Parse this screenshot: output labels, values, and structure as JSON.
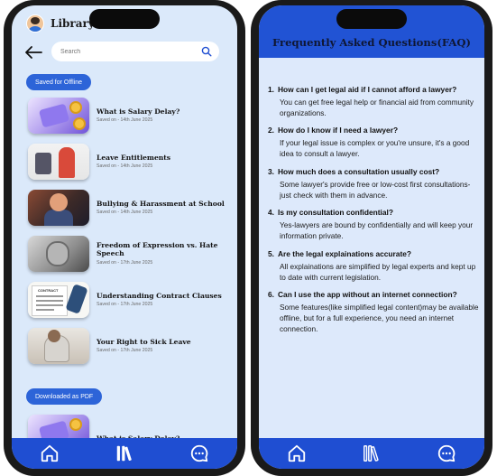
{
  "left": {
    "header": {
      "title": "Library"
    },
    "search": {
      "placeholder": "Search"
    },
    "sections": {
      "offline_label": "Saved for Offline",
      "downloaded_label": "Downloaded as PDF"
    },
    "items": [
      {
        "title": "What is Salary Delay?",
        "saved": "Saved on - 14th June 2025"
      },
      {
        "title": "Leave Entitlements",
        "saved": "Saved on - 14th June 2025"
      },
      {
        "title": "Bullying & Harassment at School",
        "saved": "Saved on - 14th June 2025"
      },
      {
        "title": "Freedom of Expression vs. Hate Speech",
        "saved": "Saved on - 17th June 2025"
      },
      {
        "title": "Understanding Contract Clauses",
        "saved": "Saved on - 17th June 2025"
      },
      {
        "title": "Your Right to Sick Leave",
        "saved": "Saved on - 17th June 2025"
      }
    ],
    "downloaded_items": [
      {
        "title": "What is Salary Delay?"
      }
    ],
    "contract_thumb_text": "CONTRACT"
  },
  "right": {
    "title": "Frequently Asked Questions(FAQ)",
    "faqs": [
      {
        "num": "1.",
        "q": "How can I get legal aid if I cannot afford a lawyer?",
        "a": "You can get free legal help or financial aid from community organizations."
      },
      {
        "num": "2.",
        "q": "How do I know if I need a lawyer?",
        "a": "If your legal issue is complex or you're unsure, it's a good idea to consult a lawyer."
      },
      {
        "num": "3.",
        "q": "How much does a consultation usually cost?",
        "a": "Some lawyer's provide free or low-cost first consultations-just check with them in advance."
      },
      {
        "num": "4.",
        "q": "Is my consultation confidential?",
        "a": "Yes-lawyers are bound by confidentially and will keep your information private."
      },
      {
        "num": "5.",
        "q": "Are the legal explainations accurate?",
        "a": "All explainations are simplified by legal experts and kept up to date with current legislation."
      },
      {
        "num": "6.",
        "q": "Can I use the app without an internet connection?",
        "a": "Some features(like simplified legal content)may be available offline, but for a full experience, you need an internet connection."
      }
    ]
  },
  "colors": {
    "accent": "#2153d4",
    "screen_bg": "#dbe9fa",
    "pill": "#2d64d8"
  },
  "icons": {
    "tab_home": "home-icon",
    "tab_library": "library-icon",
    "tab_chat": "chat-icon",
    "back": "arrow-left-icon",
    "search": "search-icon"
  }
}
